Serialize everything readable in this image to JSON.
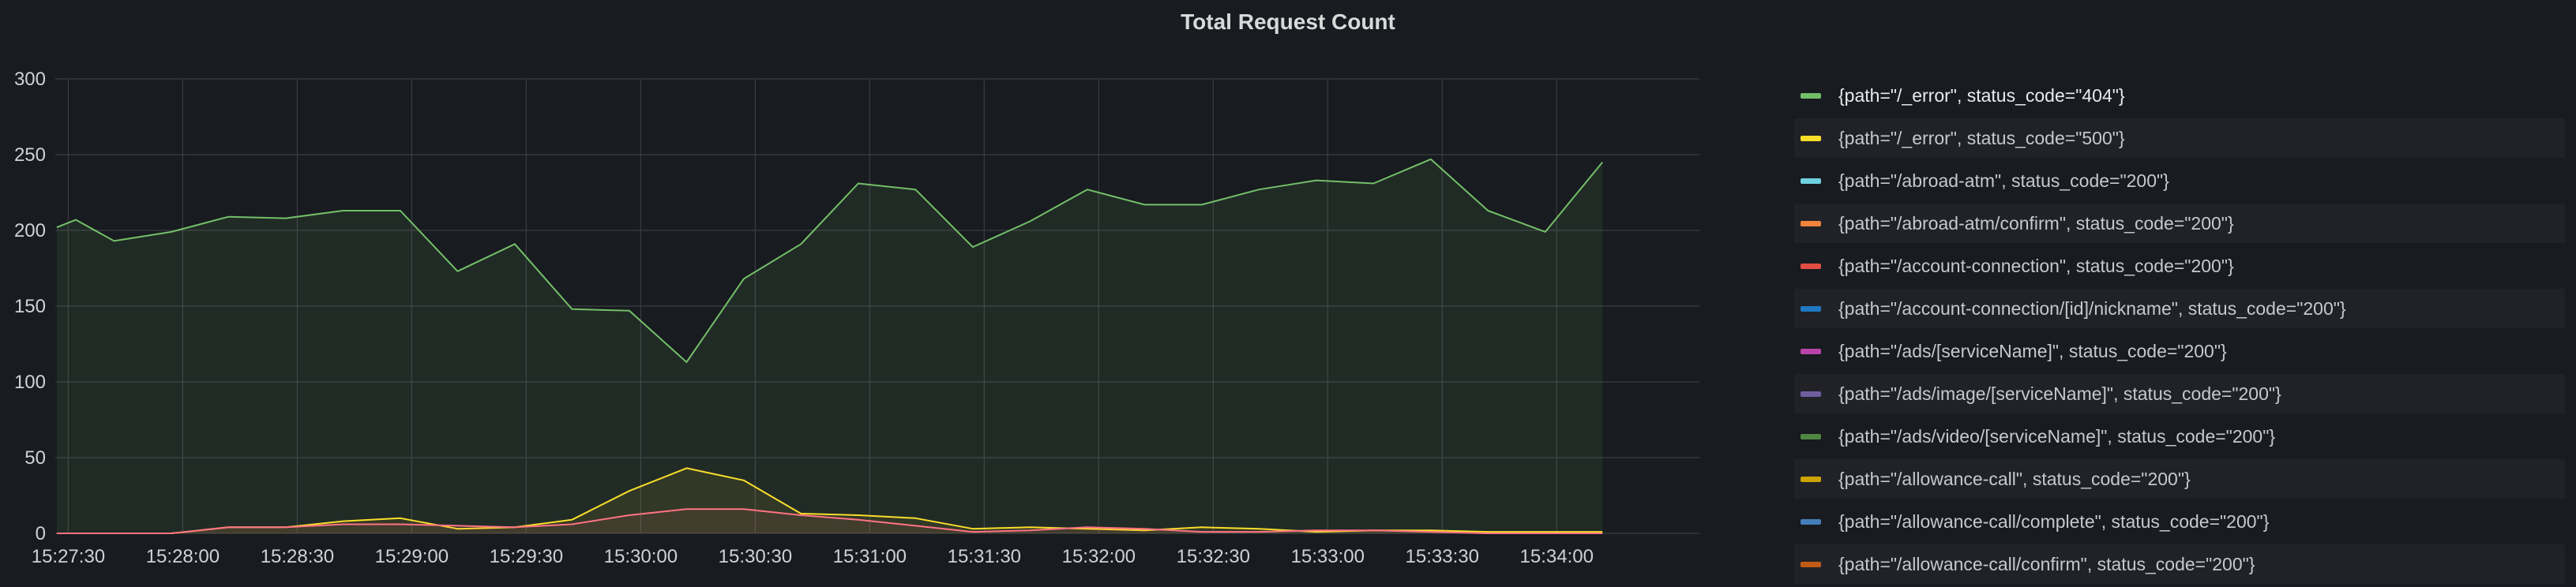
{
  "panel": {
    "title": "Total Request Count"
  },
  "chart_data": {
    "type": "area",
    "title": "Total Request Count",
    "xlabel": "",
    "ylabel": "",
    "ylim": [
      0,
      300
    ],
    "y_ticks": [
      0,
      50,
      100,
      150,
      200,
      250,
      300
    ],
    "x_tick_labels": [
      "15:27:30",
      "15:28:00",
      "15:28:30",
      "15:29:00",
      "15:29:30",
      "15:30:00",
      "15:30:30",
      "15:31:00",
      "15:31:30",
      "15:32:00",
      "15:32:30",
      "15:33:00",
      "15:33:30",
      "15:34:00"
    ],
    "x_tick_seconds": [
      0,
      30,
      60,
      90,
      120,
      150,
      180,
      210,
      240,
      270,
      300,
      330,
      360,
      390
    ],
    "x_range_seconds": [
      -3.4,
      427.4
    ],
    "grid": true,
    "legend_position": "right",
    "x_seconds": [
      -3,
      2,
      12,
      27,
      42,
      57,
      72,
      87,
      102,
      117,
      132,
      147,
      162,
      177,
      192,
      207,
      222,
      237,
      252,
      267,
      282,
      297,
      312,
      327,
      342,
      357,
      372,
      387,
      402,
      417
    ],
    "series": [
      {
        "name": "{path=\"/_error\", status_code=\"404\"}",
        "color": "#73bf69",
        "values": [
          202,
          207,
          193,
          199,
          209,
          208,
          213,
          213,
          173,
          191,
          148,
          147,
          113,
          168,
          191,
          231,
          227,
          189,
          206,
          227,
          217,
          217,
          227,
          233,
          231,
          247,
          213,
          199,
          245,
          null
        ]
      },
      {
        "name": "{path=\"/_error\", status_code=\"500\"}",
        "color": "#fade2a",
        "values": [
          0,
          0,
          0,
          0,
          4,
          4,
          8,
          10,
          3,
          4,
          9,
          28,
          43,
          35,
          13,
          12,
          10,
          3,
          4,
          3,
          2,
          4,
          3,
          1,
          2,
          2,
          1,
          1,
          1,
          null
        ]
      },
      {
        "name": "{path=\"/abroad-atm\", status_code=\"200\"}",
        "color": "#ff7383",
        "values": [
          0,
          0,
          0,
          0,
          4,
          4,
          6,
          6,
          5,
          4,
          6,
          12,
          16,
          16,
          12,
          9,
          5,
          1,
          2,
          4,
          3,
          1,
          1,
          2,
          2,
          1,
          0,
          0,
          0,
          null
        ]
      }
    ],
    "legend": [
      {
        "label": "{path=\"/_error\", status_code=\"404\"}",
        "color": "#73bf69"
      },
      {
        "label": "{path=\"/_error\", status_code=\"500\"}",
        "color": "#fade2a"
      },
      {
        "label": "{path=\"/abroad-atm\", status_code=\"200\"}",
        "color": "#6ed0e0"
      },
      {
        "label": "{path=\"/abroad-atm/confirm\", status_code=\"200\"}",
        "color": "#ef843c"
      },
      {
        "label": "{path=\"/account-connection\", status_code=\"200\"}",
        "color": "#e24d42"
      },
      {
        "label": "{path=\"/account-connection/[id]/nickname\", status_code=\"200\"}",
        "color": "#1f78c1"
      },
      {
        "label": "{path=\"/ads/[serviceName]\", status_code=\"200\"}",
        "color": "#ba43a9"
      },
      {
        "label": "{path=\"/ads/image/[serviceName]\", status_code=\"200\"}",
        "color": "#705da0"
      },
      {
        "label": "{path=\"/ads/video/[serviceName]\", status_code=\"200\"}",
        "color": "#508642"
      },
      {
        "label": "{path=\"/allowance-call\", status_code=\"200\"}",
        "color": "#cca300"
      },
      {
        "label": "{path=\"/allowance-call/complete\", status_code=\"200\"}",
        "color": "#447ebc"
      },
      {
        "label": "{path=\"/allowance-call/confirm\", status_code=\"200\"}",
        "color": "#c15c17"
      }
    ]
  }
}
